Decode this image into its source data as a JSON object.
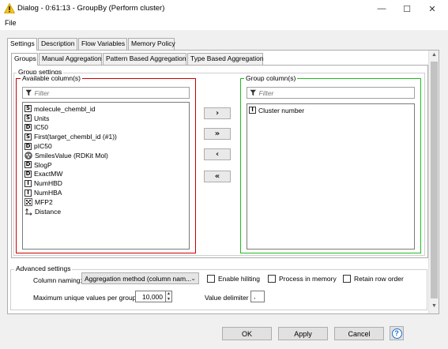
{
  "window": {
    "title": "Dialog - 0:61:13 - GroupBy (Perform cluster)",
    "minimize": "—",
    "maximize": "☐",
    "close": "✕"
  },
  "menu": {
    "file": "File"
  },
  "outer_tabs": [
    "Settings",
    "Description",
    "Flow Variables",
    "Memory Policy"
  ],
  "inner_tabs": [
    "Groups",
    "Manual Aggregation",
    "Pattern Based Aggregation",
    "Type Based Aggregation"
  ],
  "group_settings": {
    "label": "Group settings",
    "available": {
      "label": "Available column(s)",
      "filter_placeholder": "Filter",
      "items": [
        {
          "type": "S",
          "name": "molecule_chembl_id"
        },
        {
          "type": "S",
          "name": "Units"
        },
        {
          "type": "D",
          "name": "IC50"
        },
        {
          "type": "S",
          "name": "First(target_chembl_id (#1))"
        },
        {
          "type": "D",
          "name": "pIC50"
        },
        {
          "type": "mol",
          "name": "SmilesValue (RDKit Mol)"
        },
        {
          "type": "D",
          "name": "SlogP"
        },
        {
          "type": "D",
          "name": "ExactMW"
        },
        {
          "type": "I",
          "name": "NumHBD"
        },
        {
          "type": "I",
          "name": "NumHBA"
        },
        {
          "type": "bv",
          "name": "MFP2"
        },
        {
          "type": "dist",
          "name": "Distance"
        }
      ]
    },
    "buttons": {
      "add": "›",
      "add_all": "»",
      "remove": "‹",
      "remove_all": "«"
    },
    "group": {
      "label": "Group column(s)",
      "filter_placeholder": "Filter",
      "items": [
        {
          "type": "I",
          "name": "Cluster number"
        }
      ]
    }
  },
  "advanced": {
    "label": "Advanced settings",
    "column_naming_label": "Column naming:",
    "column_naming_value": "Aggregation method (column nam...",
    "enable_hiliting": "Enable hiliting",
    "process_in_memory": "Process in memory",
    "retain_row_order": "Retain row order",
    "max_unique_label": "Maximum unique values per group",
    "max_unique_value": "10,000",
    "value_delimiter_label": "Value delimiter",
    "value_delimiter_value": ","
  },
  "footer": {
    "ok": "OK",
    "apply": "Apply",
    "cancel": "Cancel",
    "help": "?"
  },
  "colors": {
    "available_border": "#cc0000",
    "group_border": "#22bb22",
    "help_ring": "#1e6fd0"
  }
}
